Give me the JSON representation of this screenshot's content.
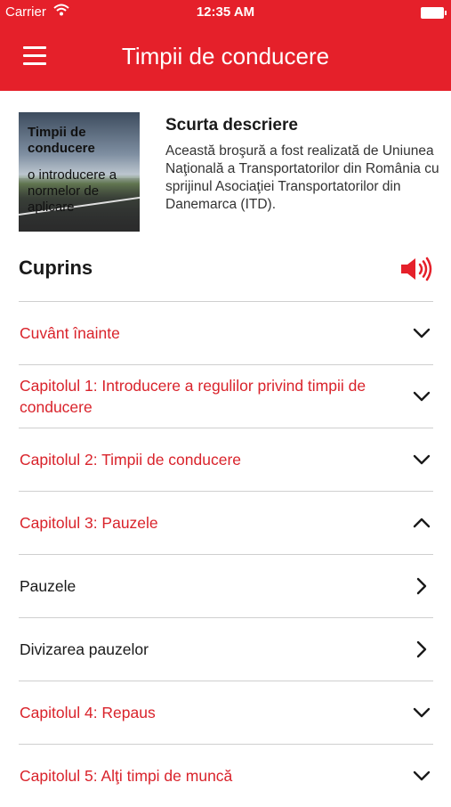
{
  "status_bar": {
    "carrier": "Carrier",
    "time": "12:35 AM"
  },
  "nav": {
    "title": "Timpii de conducere",
    "menu_icon": "hamburger-icon"
  },
  "cover": {
    "line1": "Timpii de conducere",
    "line2": "o introducere a normelor de aplicare"
  },
  "description": {
    "title": "Scurta descriere",
    "body": "Această broşură a fost realizată de Uniunea Naţională a Transportatorilor din România cu sprijinul Asociaţiei Transportatorilor din Danemarca (ITD)."
  },
  "toc": {
    "title": "Cuprins",
    "audio_icon": "speaker-icon",
    "items": [
      {
        "label": "Cuvânt înainte",
        "kind": "chapter",
        "icon": "chevron-down-icon"
      },
      {
        "label": "Capitolul 1: Introducere a regulilor privind timpii de conducere",
        "kind": "chapter",
        "icon": "chevron-down-icon"
      },
      {
        "label": "Capitolul 2: Timpii de conducere",
        "kind": "chapter",
        "icon": "chevron-down-icon"
      },
      {
        "label": "Capitolul 3: Pauzele",
        "kind": "chapter",
        "icon": "chevron-up-icon"
      },
      {
        "label": "Pauzele",
        "kind": "sub",
        "icon": "chevron-right-icon"
      },
      {
        "label": "Divizarea pauzelor",
        "kind": "sub",
        "icon": "chevron-right-icon"
      },
      {
        "label": "Capitolul 4: Repaus",
        "kind": "chapter",
        "icon": "chevron-down-icon"
      },
      {
        "label": "Capitolul 5: Alţi timpi de muncă",
        "kind": "chapter",
        "icon": "chevron-down-icon"
      }
    ]
  },
  "colors": {
    "accent": "#e5202a",
    "chapter_text": "#d9232b",
    "divider": "#cfcfcf"
  }
}
